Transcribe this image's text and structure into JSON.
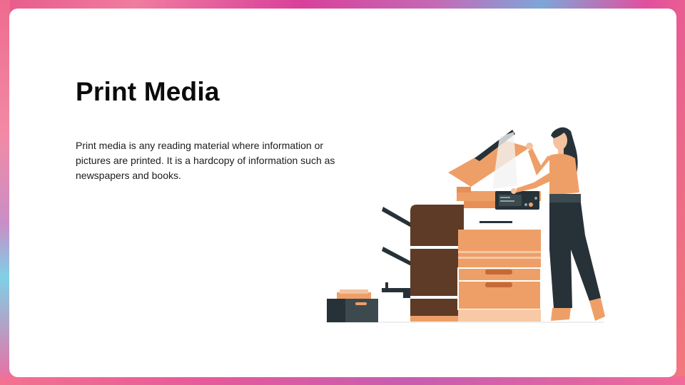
{
  "slide": {
    "title": "Print Media",
    "body": "Print media is any reading material where information or pictures are printed. It is a hardcopy of information such as newspapers and books."
  },
  "illustration": {
    "icon": "woman-using-photocopier-illustration"
  },
  "colors": {
    "accent_orange": "#ee9f67",
    "dark_brown": "#5e3b26",
    "navy": "#263238"
  }
}
